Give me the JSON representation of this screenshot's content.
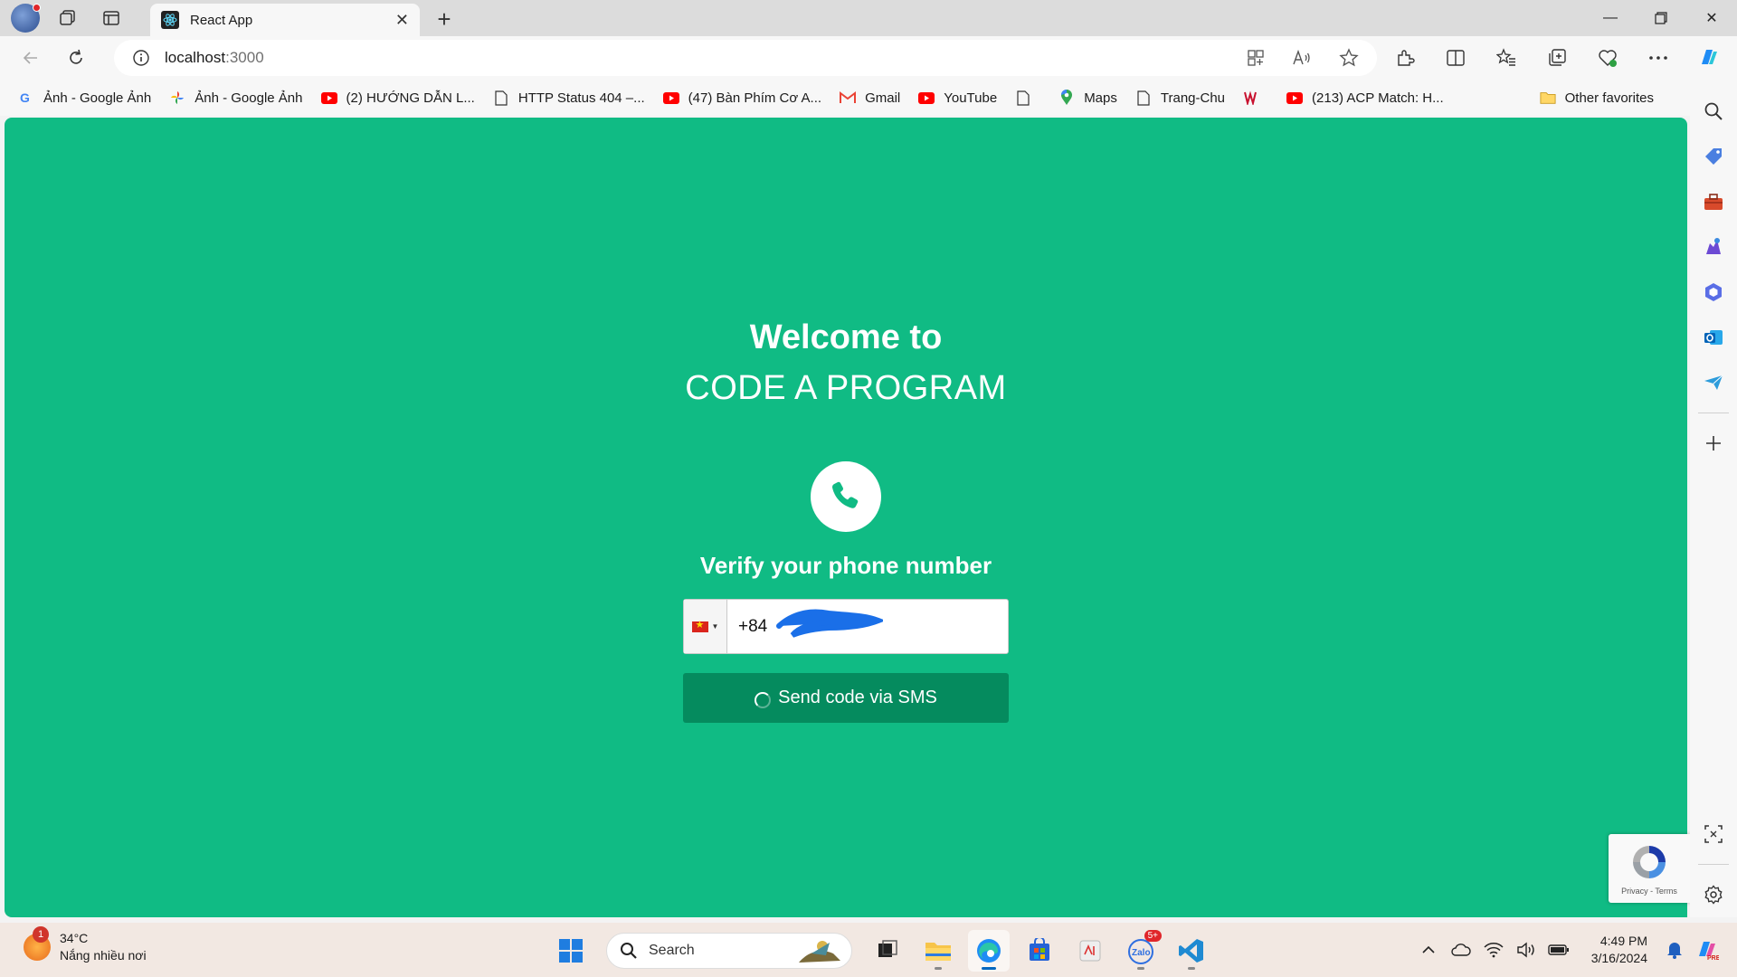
{
  "browser": {
    "tab_title": "React App",
    "url_host": "localhost",
    "url_port": ":3000"
  },
  "bookmarks": [
    {
      "label": "Ảnh - Google Ảnh",
      "icon": "google-icon"
    },
    {
      "label": "Ảnh - Google Ảnh",
      "icon": "google-photos-icon"
    },
    {
      "label": "(2) HƯỚNG DẪN L...",
      "icon": "youtube-icon"
    },
    {
      "label": "HTTP Status 404 –...",
      "icon": "page-icon"
    },
    {
      "label": "(47) Bàn Phím Cơ A...",
      "icon": "youtube-icon"
    },
    {
      "label": "Gmail",
      "icon": "gmail-icon"
    },
    {
      "label": "YouTube",
      "icon": "youtube-icon"
    },
    {
      "label": "",
      "icon": "page-icon"
    },
    {
      "label": "Maps",
      "icon": "maps-icon"
    },
    {
      "label": "Trang-Chu",
      "icon": "page-icon"
    },
    {
      "label": "",
      "icon": "site-icon"
    },
    {
      "label": "(213) ACP Match: H...",
      "icon": "youtube-icon"
    }
  ],
  "other_favorites": "Other favorites",
  "page": {
    "welcome": "Welcome to",
    "brand": "CODE A PROGRAM",
    "verify_title": "Verify your phone number",
    "phone_value": "+84",
    "send_button": "Send code via SMS",
    "recaptcha_terms": "Privacy - Terms"
  },
  "taskbar": {
    "temperature": "34°C",
    "weather_desc": "Nắng nhiều nơi",
    "weather_badge": "1",
    "search_label": "Search",
    "zalo_badge": "5+",
    "time": "4:49 PM",
    "date": "3/16/2024"
  },
  "colors": {
    "page_bg": "#10bb84",
    "button_bg": "#058b5e"
  }
}
